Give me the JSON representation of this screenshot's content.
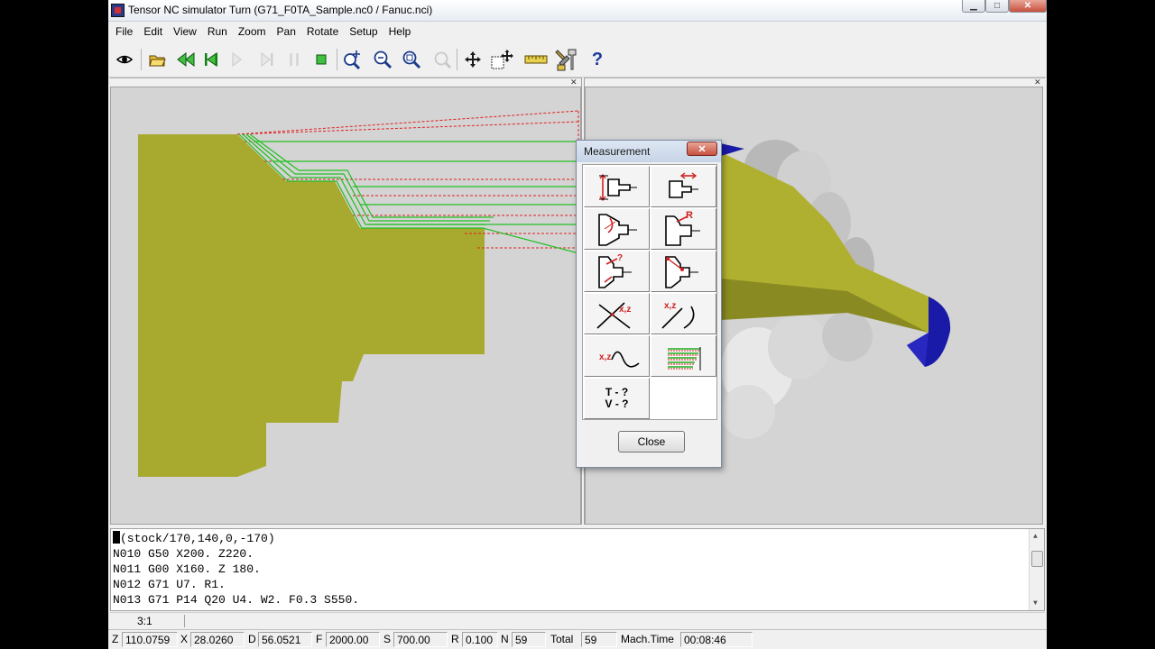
{
  "window": {
    "title": "Tensor NC simulator Turn (G71_F0TA_Sample.nc0 / Fanuc.nci)",
    "min_glyph": "▁",
    "max_glyph": "□",
    "close_glyph": "✕"
  },
  "menu": [
    "File",
    "Edit",
    "View",
    "Run",
    "Zoom",
    "Pan",
    "Rotate",
    "Setup",
    "Help"
  ],
  "toolbar": {
    "icons": [
      "eye-icon",
      "open-folder-icon",
      "rewind-icon",
      "step-start-icon",
      "play-icon",
      "step-end-icon",
      "pause-icon",
      "stop-icon",
      "zoom-in-icon",
      "zoom-out-icon",
      "zoom-fit-icon",
      "zoom-rotate-icon",
      "pan-icon",
      "pan-window-icon",
      "ruler-icon",
      "tools-icon",
      "help-icon"
    ],
    "help_glyph": "?"
  },
  "viewport_close_glyph": "✕",
  "measurement_dialog": {
    "title": "Measurement",
    "close_glyph": "✕",
    "close_label": "Close",
    "xz_label": "x,z",
    "r_label": "R",
    "q_label": "?",
    "tv_lines": [
      "T - ?",
      "V - ?"
    ]
  },
  "code": {
    "lines": [
      "(stock/170,140,0,-170)",
      "N010 G50 X200. Z220.",
      "N011 G00 X160. Z 180.",
      "N012 G71 U7. R1.",
      "N013 G71 P14 Q20 U4. W2. F0.3 S550."
    ]
  },
  "zoom": "3:1",
  "status": {
    "z_label": "Z",
    "z_value": "110.0759",
    "x_label": "X",
    "x_value": "28.0260",
    "d_label": "D",
    "d_value": "56.0521",
    "f_label": "F",
    "f_value": "2000.00",
    "s_label": "S",
    "s_value": "700.00",
    "r_label": "R",
    "r_value": "0.100",
    "n_label": "N",
    "n_value": "59",
    "total_label": "Total",
    "total_value": "59",
    "mach_label": "Mach.Time",
    "mach_value": "00:08:46"
  },
  "colors": {
    "part": "#a8aa30",
    "toolpath_cut": "#20c020",
    "toolpath_rapid": "#e02020",
    "stock_end": "#1a1aa8"
  }
}
